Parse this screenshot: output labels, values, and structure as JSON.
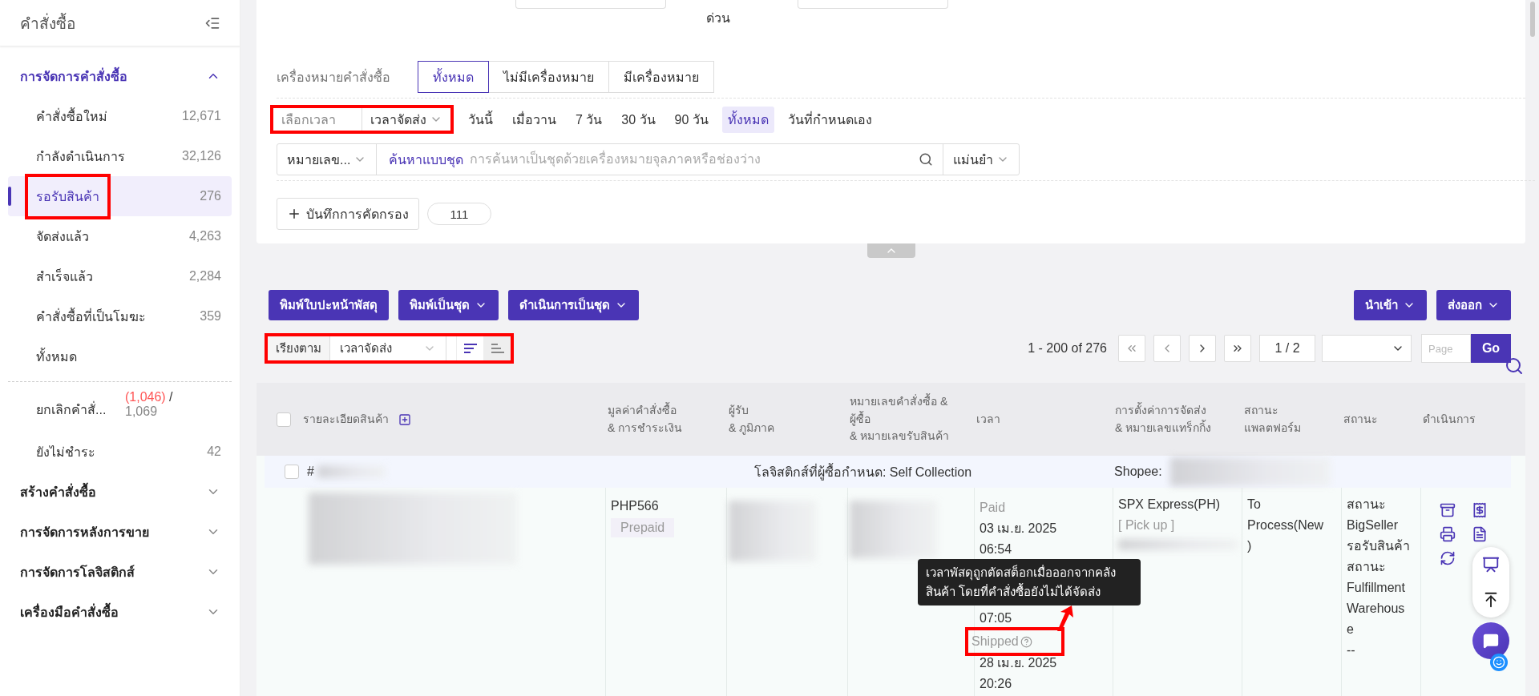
{
  "sidebar": {
    "title": "คำสั่งซื้อ",
    "sections": [
      {
        "label": "การจัดการคำสั่งซื้อ",
        "expanded": true,
        "items": [
          {
            "kind": "count",
            "label": "คำสั่งซื้อใหม่",
            "count": "12,671",
            "selected": false,
            "highlight": false
          },
          {
            "kind": "count",
            "label": "กำลังดำเนินการ",
            "count": "32,126",
            "selected": false,
            "highlight": false
          },
          {
            "kind": "count",
            "label": "รอรับสินค้า",
            "count": "276",
            "selected": true,
            "highlight": true
          },
          {
            "kind": "count",
            "label": "จัดส่งแล้ว",
            "count": "4,263",
            "selected": false,
            "highlight": false
          },
          {
            "kind": "count",
            "label": "สำเร็จแล้ว",
            "count": "2,284",
            "selected": false,
            "highlight": false
          },
          {
            "kind": "count",
            "label": "คำสั่งซื้อที่เป็นโมฆะ",
            "count": "359",
            "selected": false,
            "highlight": false
          },
          {
            "kind": "count",
            "label": "ทั้งหมด",
            "selected": false,
            "highlight": false
          },
          {
            "kind": "divider"
          },
          {
            "kind": "split",
            "label": "ยกเลิกคำสั่...",
            "alert_count": "(1,046)",
            "separator": "/",
            "count": "1,069",
            "selected": false,
            "highlight": false
          },
          {
            "kind": "count",
            "label": "ยังไม่ชำระ",
            "count": "42",
            "selected": false,
            "highlight": false
          }
        ]
      },
      {
        "label": "สร้างคำสั่งซื้อ",
        "expanded": false
      },
      {
        "label": "การจัดการหลังการขาย",
        "expanded": false
      },
      {
        "label": "การจัดการโลจิสติกส์",
        "expanded": false
      },
      {
        "label": "เครื่องมือคำสั่งซื้อ",
        "expanded": false
      }
    ]
  },
  "filters": {
    "top_label": "ด่วน",
    "order_mark": {
      "label": "เครื่องหมายคำสั่งซื้อ",
      "options": [
        {
          "label": "ทั้งหมด",
          "selected": true
        },
        {
          "label": "ไม่มีเครื่องหมาย",
          "selected": false
        },
        {
          "label": "มีเครื่องหมาย",
          "selected": false
        }
      ]
    },
    "time": {
      "label": "เลือกเวลา",
      "field": "เวลาจัดส่ง",
      "highlight": true,
      "ranges": [
        {
          "label": "วันนี้",
          "selected": false
        },
        {
          "label": "เมื่อวาน",
          "selected": false
        },
        {
          "label": "7 วัน",
          "selected": false
        },
        {
          "label": "30 วัน",
          "selected": false
        },
        {
          "label": "90 วัน",
          "selected": false
        },
        {
          "label": "ทั้งหมด",
          "selected": true
        },
        {
          "label": "วันที่กำหนดเอง",
          "selected": false
        }
      ]
    },
    "search": {
      "field": "หมายเลข...",
      "batch_link": "ค้นหาแบบชุด",
      "placeholder": "การค้นหาเป็นชุดด้วยเครื่องหมายจุลภาคหรือช่องว่าง",
      "match": "แม่นยำ"
    },
    "saved": {
      "button": "บันทึกการคัดกรอง",
      "value": "111"
    }
  },
  "toolbar": {
    "left": [
      {
        "label": "พิมพ์ใบปะหน้าพัสดุ",
        "dropdown": false
      },
      {
        "label": "พิมพ์เป็นชุด",
        "dropdown": true
      },
      {
        "label": "ดำเนินการเป็นชุด",
        "dropdown": true
      }
    ],
    "right": [
      {
        "label": "นำเข้า",
        "dropdown": true
      },
      {
        "label": "ส่งออก",
        "dropdown": true
      }
    ]
  },
  "sort": {
    "label": "เรียงตาม",
    "field": "เวลาจัดส่ง",
    "highlight": true,
    "directions": [
      {
        "kind": "descending",
        "selected": true
      },
      {
        "kind": "ascending",
        "selected": false
      }
    ]
  },
  "pagination": {
    "range": "1 - 200 of 276",
    "page": "1 / 2",
    "page_placeholder": "Page",
    "go": "Go"
  },
  "table": {
    "select_all_checked": false,
    "columns": [
      {
        "lines": [
          "รายละเอียดสินค้า"
        ],
        "expand": true
      },
      {
        "lines": [
          "มูลค่าคำสั่งซื้อ",
          "& การชำระเงิน"
        ]
      },
      {
        "lines": [
          "ผู้รับ",
          "& ภูมิภาค"
        ]
      },
      {
        "lines": [
          "หมายเลขคำสั่งซื้อ &",
          "ผู้ซื้อ",
          "& หมายเลขรับสินค้า"
        ]
      },
      {
        "lines": [
          "เวลา"
        ]
      },
      {
        "lines": [
          "การตั้งค่าการจัดส่ง",
          "& หมายเลขแทร็กกิ้ง"
        ]
      },
      {
        "lines": [
          "สถานะ",
          "แพลตฟอร์ม"
        ]
      },
      {
        "lines": [
          "สถานะ"
        ]
      },
      {
        "lines": [
          "ดำเนินการ"
        ]
      }
    ],
    "order": {
      "checked": false,
      "number_prefix": "#",
      "logistics": "โลจิสติกส์ที่ผู้ซื้อกำหนด: Self Collection",
      "store": "Shopee:",
      "amount": "PHP566",
      "payment": "Prepaid",
      "times": [
        {
          "kind": "label",
          "text": "Paid"
        },
        {
          "kind": "value",
          "text": "03 เม.ย. 2025"
        },
        {
          "kind": "value",
          "text": "06:54"
        },
        {
          "kind": "gap"
        },
        {
          "kind": "gap"
        },
        {
          "kind": "value",
          "text": "07:05"
        },
        {
          "kind": "label",
          "text": "Shipped",
          "help": true,
          "highlight": true
        },
        {
          "kind": "value",
          "text": "28 เม.ย. 2025"
        },
        {
          "kind": "value",
          "text": "20:26"
        }
      ],
      "carrier": "SPX Express(PH)",
      "method": "[ Pick up ]",
      "platform_status": [
        "To",
        "Process(New",
        ")"
      ],
      "status": [
        "สถานะ",
        "BigSeller",
        "รอรับสินค้า",
        "สถานะ",
        "Fulfillment",
        "Warehous",
        "e",
        "--"
      ]
    },
    "tooltip": {
      "lines": [
        "เวลาพัสดุถูกตัดสต็อกเมื่อออกจากคลัง",
        "สินค้า โดยที่คำสั่งซื้อยังไม่ได้จัดส่ง"
      ]
    }
  }
}
